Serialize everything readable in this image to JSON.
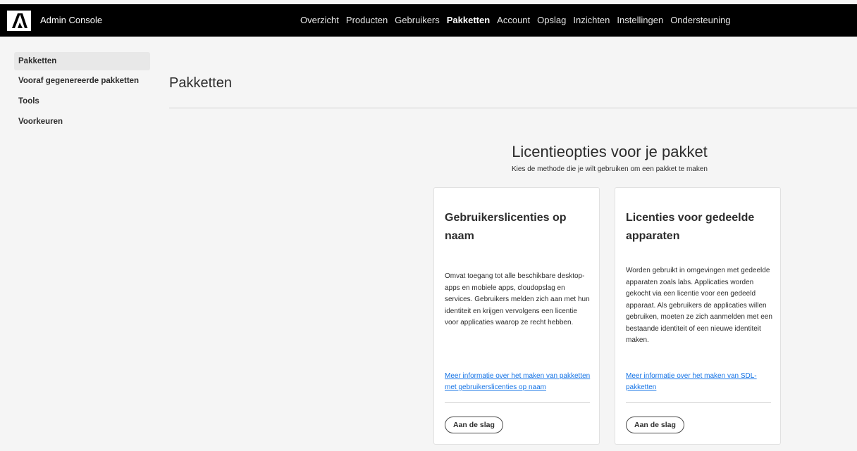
{
  "header": {
    "app_title": "Admin Console",
    "logo_icon": "adobe-logo-icon",
    "nav": [
      {
        "label": "Overzicht",
        "active": false
      },
      {
        "label": "Producten",
        "active": false
      },
      {
        "label": "Gebruikers",
        "active": false
      },
      {
        "label": "Pakketten",
        "active": true
      },
      {
        "label": "Account",
        "active": false
      },
      {
        "label": "Opslag",
        "active": false
      },
      {
        "label": "Inzichten",
        "active": false
      },
      {
        "label": "Instellingen",
        "active": false
      },
      {
        "label": "Ondersteuning",
        "active": false
      }
    ]
  },
  "sidebar": {
    "items": [
      {
        "label": "Pakketten",
        "active": true
      },
      {
        "label": "Vooraf gegenereerde pakketten",
        "active": false
      },
      {
        "label": "Tools",
        "active": false
      },
      {
        "label": "Voorkeuren",
        "active": false
      }
    ]
  },
  "main": {
    "page_title": "Pakketten",
    "license_options": {
      "title": "Licentieopties voor je pakket",
      "subtitle": "Kies de methode die je wilt gebruiken om een pakket te maken"
    },
    "cards": [
      {
        "title": "Gebruikerslicenties op naam",
        "description": "Omvat toegang tot alle beschikbare desktop-apps en mobiele apps, cloudopslag en services. Gebruikers melden zich aan met hun identiteit en krijgen vervolgens een licentie voor applicaties waarop ze recht hebben.",
        "link": "Meer informatie over het maken van pakketten met gebruikerslicenties op naam",
        "button": "Aan de slag"
      },
      {
        "title": "Licenties voor gedeelde apparaten",
        "description": "Worden gebruikt in omgevingen met gedeelde apparaten zoals labs. Applicaties worden gekocht via een licentie voor een gedeeld apparaat. Als gebruikers de applicaties willen gebruiken, moeten ze zich aanmelden met een bestaande identiteit of een nieuwe identiteit maken.",
        "link": "Meer informatie over het maken van SDL-pakketten",
        "button": "Aan de slag"
      }
    ]
  },
  "colors": {
    "header_bg": "#000000",
    "page_bg": "#f5f5f5",
    "link": "#1473e6"
  }
}
